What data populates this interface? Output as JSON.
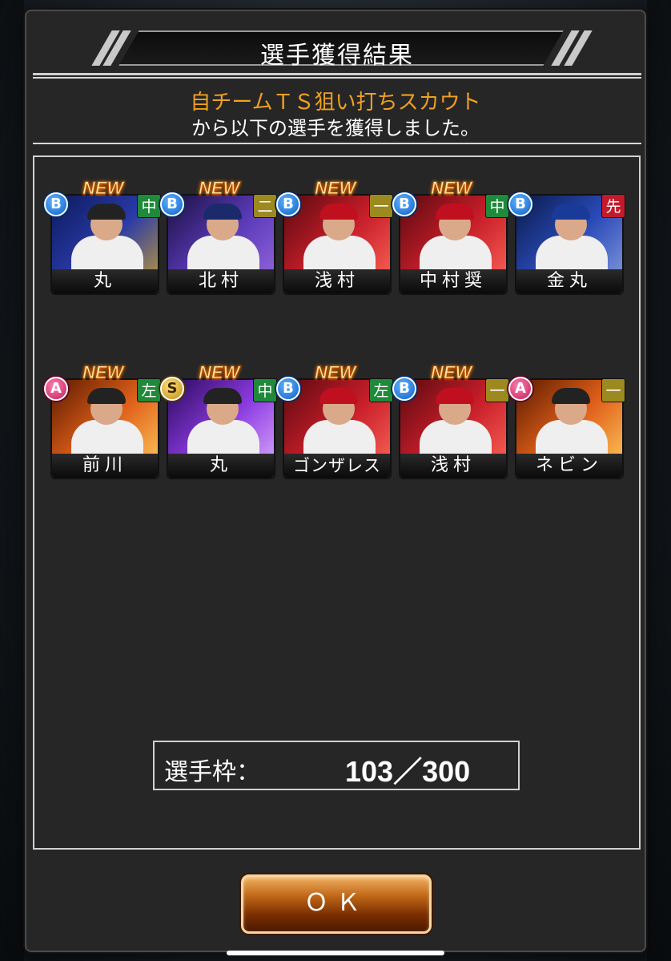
{
  "dialog": {
    "title": "選手獲得結果",
    "subtitle": "自チームＴＳ狙い打ちスカウト",
    "message": "から以下の選手を獲得しました。",
    "ok_label": "ＯＫ"
  },
  "slots": {
    "label": "選手枠：",
    "value": "103／300"
  },
  "colors": {
    "subtitle": "#f0a020",
    "ok_button": "#a0501a"
  },
  "cards": [
    {
      "name": "丸",
      "rank": "B",
      "position": "中",
      "position_color": "green",
      "new": "NEW",
      "bg": "blue-dark"
    },
    {
      "name": "北村",
      "rank": "B",
      "position": "二",
      "position_color": "olive",
      "new": "NEW",
      "bg": "purple"
    },
    {
      "name": "浅村",
      "rank": "B",
      "position": "一",
      "position_color": "olive",
      "new": "NEW",
      "bg": "red"
    },
    {
      "name": "中村奨",
      "rank": "B",
      "position": "中",
      "position_color": "green",
      "new": "NEW",
      "bg": "red"
    },
    {
      "name": "金丸",
      "rank": "B",
      "position": "先",
      "position_color": "red",
      "new": "",
      "bg": "navy"
    },
    {
      "name": "前川",
      "rank": "A",
      "position": "左",
      "position_color": "green",
      "new": "NEW",
      "bg": "fire"
    },
    {
      "name": "丸",
      "rank": "S",
      "position": "中",
      "position_color": "green",
      "new": "NEW",
      "bg": "violet"
    },
    {
      "name": "ゴンザレス",
      "rank": "B",
      "position": "左",
      "position_color": "green",
      "new": "NEW",
      "bg": "red"
    },
    {
      "name": "浅村",
      "rank": "B",
      "position": "一",
      "position_color": "olive",
      "new": "NEW",
      "bg": "red"
    },
    {
      "name": "ネビン",
      "rank": "A",
      "position": "一",
      "position_color": "olive",
      "new": "",
      "bg": "fire"
    }
  ]
}
